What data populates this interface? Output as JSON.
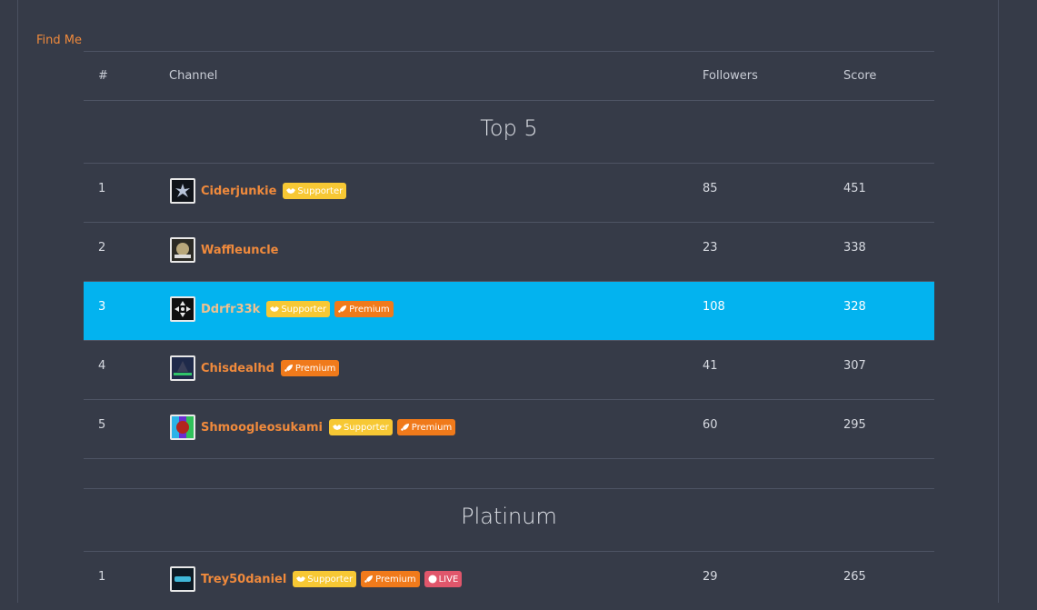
{
  "find_me": "Find Me",
  "header": {
    "rank": "#",
    "channel": "Channel",
    "followers": "Followers",
    "score": "Score"
  },
  "sections": [
    {
      "title": "Top 5",
      "rows": [
        {
          "rank": "1",
          "name": "Ciderjunkie",
          "followers": "85",
          "score": "451",
          "badges": [
            "Supporter"
          ]
        },
        {
          "rank": "2",
          "name": "Waffleuncle",
          "followers": "23",
          "score": "338",
          "badges": []
        },
        {
          "rank": "3",
          "name": "Ddrfr33k",
          "followers": "108",
          "score": "328",
          "badges": [
            "Supporter",
            "Premium"
          ]
        },
        {
          "rank": "4",
          "name": "Chisdealhd",
          "followers": "41",
          "score": "307",
          "badges": [
            "Premium"
          ]
        },
        {
          "rank": "5",
          "name": "Shmoogleosukami",
          "followers": "60",
          "score": "295",
          "badges": [
            "Supporter",
            "Premium"
          ]
        }
      ]
    },
    {
      "title": "Platinum",
      "rows": [
        {
          "rank": "1",
          "name": "Trey50daniel",
          "followers": "29",
          "score": "265",
          "badges": [
            "Supporter",
            "Premium",
            "LIVE"
          ]
        }
      ]
    }
  ],
  "colors": {
    "background": "#363b48",
    "accent_orange": "#f08a3c",
    "highlight": "#03b3ef",
    "supporter": "#f7c834",
    "premium": "#f07a1b",
    "live": "#e0566b"
  }
}
